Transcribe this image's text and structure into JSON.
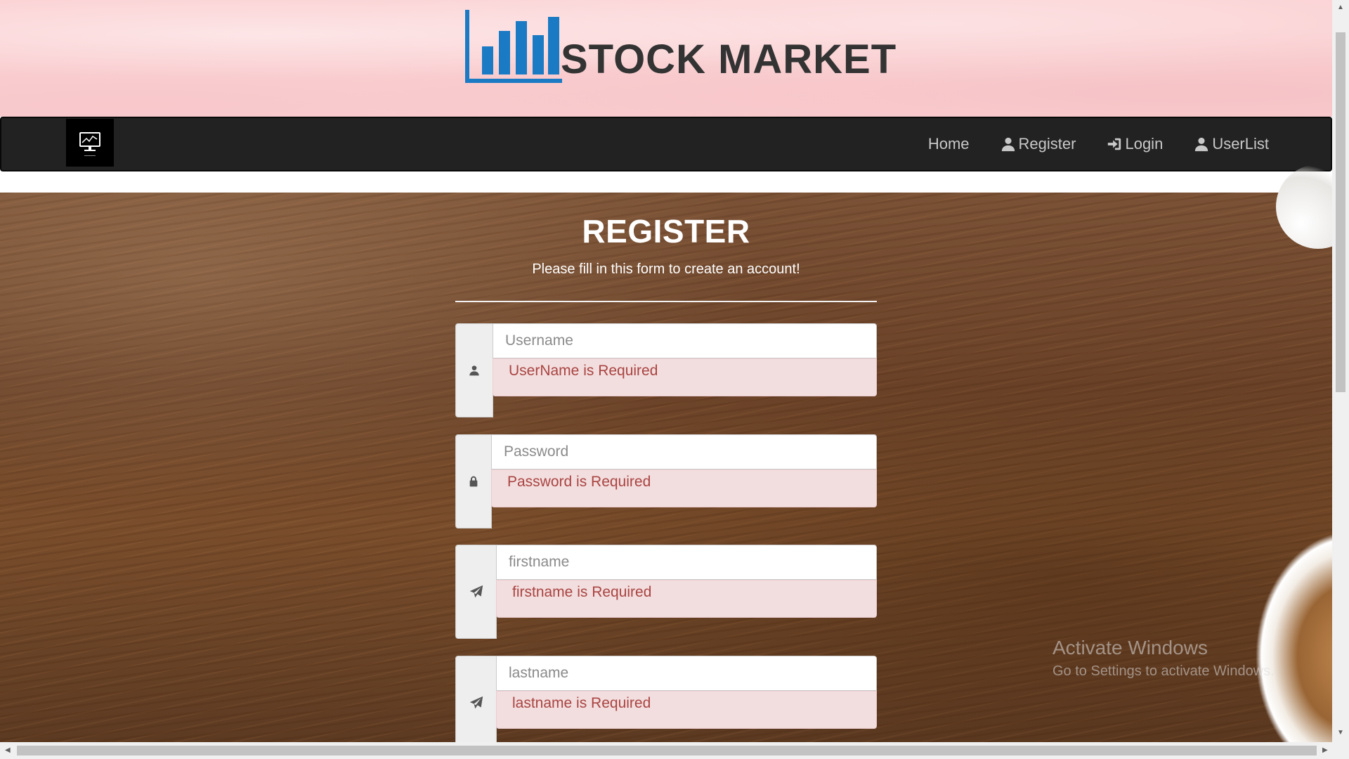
{
  "header": {
    "title": "STOCK MARKET"
  },
  "navbar": {
    "items": [
      {
        "label": "Home",
        "icon": ""
      },
      {
        "label": "Register",
        "icon": "user-icon"
      },
      {
        "label": "Login",
        "icon": "login-icon"
      },
      {
        "label": "UserList",
        "icon": "user-icon"
      }
    ]
  },
  "form": {
    "title": "REGISTER",
    "subtitle": "Please fill in this form to create an account!",
    "fields": [
      {
        "placeholder": "Username",
        "error": "UserName is Required",
        "icon": "user-icon"
      },
      {
        "placeholder": "Password",
        "error": "Password is Required",
        "icon": "lock-icon"
      },
      {
        "placeholder": "firstname",
        "error": "firstname is Required",
        "icon": "paper-plane-icon"
      },
      {
        "placeholder": "lastname",
        "error": "lastname is Required",
        "icon": "paper-plane-icon"
      }
    ]
  },
  "watermark": {
    "title": "Activate Windows",
    "subtitle": "Go to Settings to activate Windows."
  },
  "colors": {
    "banner": "#fbd1d3",
    "navbar": "#222222",
    "logo_blue": "#1a7bc4",
    "alert_bg": "#f2dede",
    "alert_text": "#a94442"
  }
}
